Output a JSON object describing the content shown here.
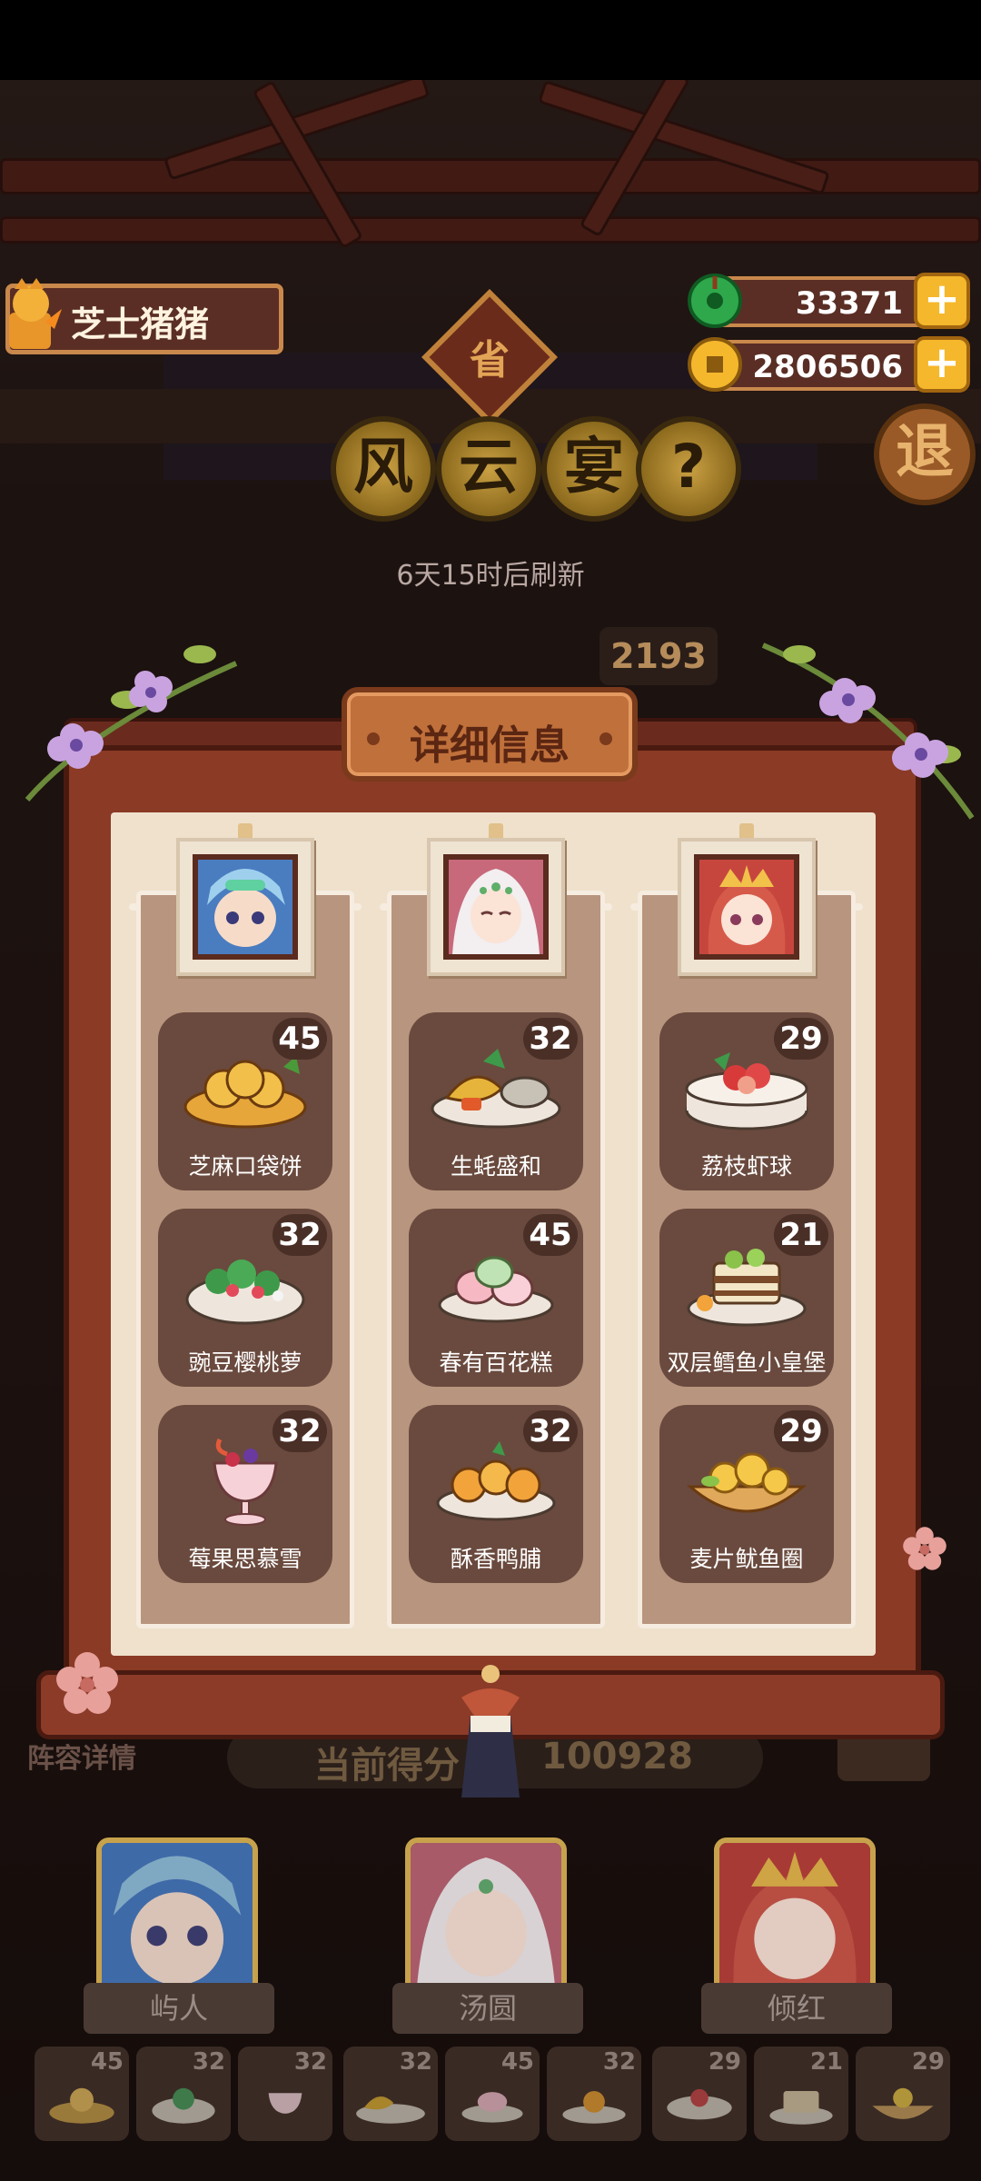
{
  "hud": {
    "player_name": "芝士猪猪",
    "jade_amount": "33371",
    "gold_amount": "2806506",
    "province_badge": "省",
    "event_title_chars": [
      "风",
      "云",
      "宴"
    ],
    "help_label": "?",
    "exit_label": "退",
    "refresh_text": "6天15时后刷新",
    "background_score": "2193"
  },
  "dialog": {
    "title": "详细信息",
    "columns": [
      {
        "character": "屿人",
        "dishes": [
          {
            "name": "芝麻口袋饼",
            "score": "45"
          },
          {
            "name": "豌豆樱桃萝",
            "score": "32"
          },
          {
            "name": "莓果思慕雪",
            "score": "32"
          }
        ]
      },
      {
        "character": "汤圆",
        "dishes": [
          {
            "name": "生蚝盛和",
            "score": "32"
          },
          {
            "name": "春有百花糕",
            "score": "45"
          },
          {
            "name": "酥香鸭脯",
            "score": "32"
          }
        ]
      },
      {
        "character": "倾红",
        "dishes": [
          {
            "name": "荔枝虾球",
            "score": "29"
          },
          {
            "name": "双层鳕鱼小皇堡",
            "score": "21"
          },
          {
            "name": "麦片鱿鱼圈",
            "score": "29"
          }
        ]
      }
    ]
  },
  "bottom": {
    "lineup_label": "阵容详情",
    "score_label": "当前得分",
    "score_value": "100928",
    "heroes": [
      "屿人",
      "汤圆",
      "倾红"
    ],
    "slot_scores": [
      "45",
      "32",
      "32",
      "32",
      "45",
      "32",
      "29",
      "21",
      "29"
    ]
  },
  "colors": {
    "frame": "#8a3a25",
    "paper": "#efe1cc",
    "dish_card": "#6a4a3e",
    "gold": "#f5b82c",
    "title_plate": "#c0703b"
  }
}
